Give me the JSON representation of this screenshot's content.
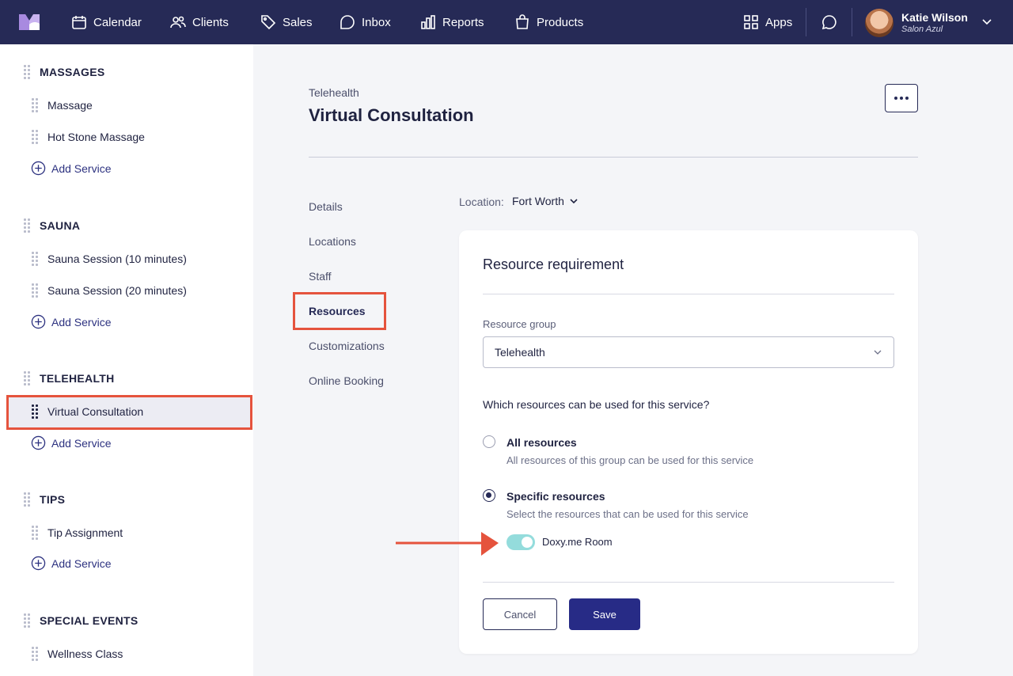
{
  "topbar": {
    "nav": [
      {
        "label": "Calendar",
        "icon": "calendar-icon"
      },
      {
        "label": "Clients",
        "icon": "users-icon"
      },
      {
        "label": "Sales",
        "icon": "tag-icon"
      },
      {
        "label": "Inbox",
        "icon": "chat-icon"
      },
      {
        "label": "Reports",
        "icon": "bar-chart-icon"
      },
      {
        "label": "Products",
        "icon": "shopping-bag-icon"
      }
    ],
    "apps_label": "Apps",
    "user": {
      "name": "Katie Wilson",
      "business": "Salon Azul"
    }
  },
  "sidebar": {
    "categories": [
      {
        "name": "MASSAGES",
        "items": [
          "Massage",
          "Hot Stone Massage"
        ]
      },
      {
        "name": "SAUNA",
        "items": [
          "Sauna Session (10 minutes)",
          "Sauna Session (20 minutes)"
        ]
      },
      {
        "name": "TELEHEALTH",
        "items": [
          "Virtual Consultation"
        ]
      },
      {
        "name": "TIPS",
        "items": [
          "Tip Assignment"
        ]
      },
      {
        "name": "SPECIAL EVENTS",
        "items": [
          "Wellness Class"
        ]
      }
    ],
    "add_label": "Add Service",
    "selected_item": "Virtual Consultation"
  },
  "page": {
    "category": "Telehealth",
    "title": "Virtual Consultation"
  },
  "subnav": [
    "Details",
    "Locations",
    "Staff",
    "Resources",
    "Customizations",
    "Online Booking"
  ],
  "subnav_active": "Resources",
  "location": {
    "label": "Location:",
    "value": "Fort Worth"
  },
  "card": {
    "title": "Resource requirement",
    "group_label": "Resource group",
    "group_value": "Telehealth",
    "question": "Which resources can be used for this service?",
    "options": [
      {
        "label": "All resources",
        "desc": "All resources of this group can be used for this service",
        "selected": false
      },
      {
        "label": "Specific resources",
        "desc": "Select the resources that can be used for this service",
        "selected": true
      }
    ],
    "resource": {
      "label": "Doxy.me Room",
      "enabled": true
    },
    "cancel_label": "Cancel",
    "save_label": "Save"
  },
  "colors": {
    "topbar": "#262a56",
    "accent": "#272b86",
    "highlight": "#e5533d",
    "toggle": "#94dcdc"
  }
}
